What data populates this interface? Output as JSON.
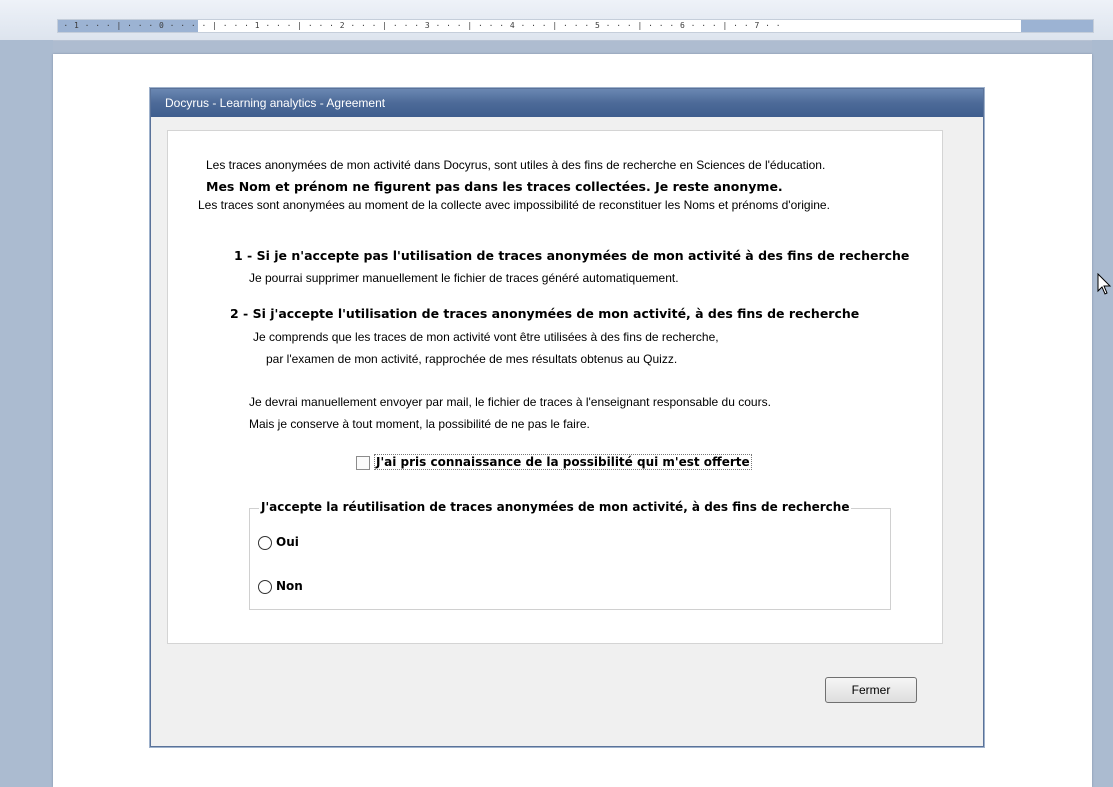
{
  "ruler": {
    "text": " · 1 · · · | · · · 0 · · · · | · · · 1 · · · | · · · 2 · · · | · · · 3 · · · | · · · 4 · · · | · · · 5 · · · | · · · 6 · · · | · · 7 · ·"
  },
  "dialog": {
    "title": "Docyrus - Learning analytics - Agreement",
    "intro_line1": "Les traces anonymées de mon activité dans Docyrus, sont utiles à des fins de recherche  en Sciences de l'éducation.",
    "intro_line2": "Mes Nom et prénom ne figurent pas dans les traces collectées. Je reste anonyme.",
    "intro_line3": "Les traces sont anonymées au moment de la collecte avec impossibilité de reconstituer les Noms et prénoms d'origine.",
    "option1_title": "1 - Si je n'accepte pas l'utilisation de traces anonymées de mon activité à des fins de recherche",
    "option1_text": "Je pourrai supprimer manuellement le fichier de traces généré automatiquement.",
    "option2_title": "2 - Si j'accepte l'utilisation de traces anonymées de mon activité, à des fins de recherche",
    "option2_text1": "Je comprends que les traces de mon activité vont être utilisées à des fins de recherche,",
    "option2_text2": "par l'examen de mon activité, rapprochée de mes résultats obtenus au Quizz.",
    "mail_line1": "Je devrai manuellement envoyer par mail, le fichier de traces à l'enseignant responsable du cours.",
    "mail_line2": "Mais je conserve à tout moment, la possibilité de ne pas le faire.",
    "checkbox_label": "J'ai pris connaissance de la possibilité qui m'est offerte",
    "checkbox_checked": false,
    "group_title": "J'accepte la réutilisation de traces anonymées de mon activité, à des fins de recherche",
    "radio_yes": "Oui",
    "radio_no": "Non",
    "close_button": "Fermer"
  }
}
